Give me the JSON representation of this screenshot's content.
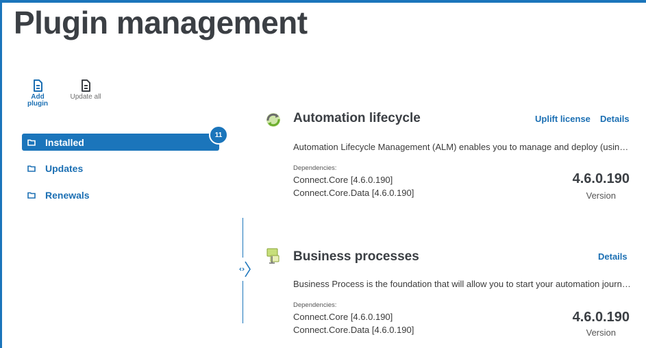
{
  "page": {
    "title": "Plugin management"
  },
  "toolbar": {
    "add_label": "Add plugin",
    "update_all_label": "Update all"
  },
  "nav": {
    "installed": "Installed",
    "updates": "Updates",
    "renewals": "Renewals",
    "installed_count": "11"
  },
  "plugins": [
    {
      "title": "Automation lifecycle",
      "actions": [
        "Uplift license",
        "Details"
      ],
      "description": "Automation Lifecycle Management (ALM) enables you to manage and deploy (using ...",
      "dependencies_label": "Dependencies:",
      "dependencies": [
        "Connect.Core [4.6.0.190]",
        "Connect.Core.Data [4.6.0.190]"
      ],
      "version": "4.6.0.190",
      "version_label": "Version",
      "icon": "refresh-cycle-icon"
    },
    {
      "title": "Business processes",
      "actions": [
        "Details"
      ],
      "description": "Business Process is the foundation that will allow you to start your automation journe...",
      "dependencies_label": "Dependencies:",
      "dependencies": [
        "Connect.Core [4.6.0.190]",
        "Connect.Core.Data [4.6.0.190]"
      ],
      "version": "4.6.0.190",
      "version_label": "Version",
      "icon": "flowchart-icon"
    }
  ],
  "colors": {
    "accent": "#1b75bb",
    "title": "#3b3f44",
    "text": "#3a3a3a"
  }
}
